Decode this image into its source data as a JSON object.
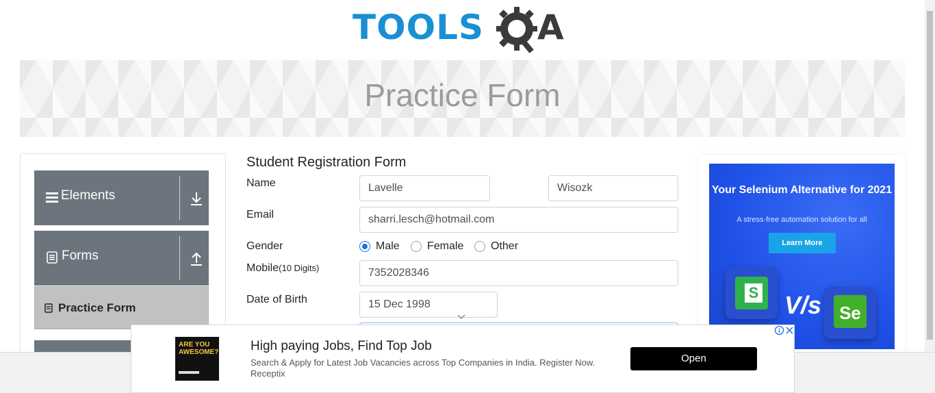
{
  "logo": {
    "text": "TOOLS",
    "suffix": "A",
    "alt": "TOOLSQA",
    "colors": {
      "tools": "#1a8fd4",
      "qa": "#3b3b3b"
    }
  },
  "banner": {
    "title": "Practice Form"
  },
  "sidebar": {
    "groups": [
      {
        "label": "Elements",
        "icon": "hamburger-icon",
        "arrow": "download-arrow-icon"
      },
      {
        "label": "Forms",
        "icon": "document-icon",
        "arrow": "upload-arrow-icon"
      }
    ],
    "active_item": {
      "label": "Practice Form",
      "icon": "form-icon"
    }
  },
  "form": {
    "title": "Student Registration Form",
    "name": {
      "label": "Name",
      "first": "Lavelle",
      "last": "Wisozk"
    },
    "email": {
      "label": "Email",
      "value": "sharri.lesch@hotmail.com"
    },
    "gender": {
      "label": "Gender",
      "options": [
        "Male",
        "Female",
        "Other"
      ],
      "selected": "Male"
    },
    "mobile": {
      "label": "Mobile",
      "hint": "(10 Digits)",
      "value": "7352028346"
    },
    "dob": {
      "label": "Date of Birth",
      "value": "15 Dec 1998"
    }
  },
  "right_ad": {
    "headline": "Your Selenium Alternative for 2021",
    "subline": "A stress-free automation solution for all",
    "button": "Learn More",
    "vs": "V/s",
    "tile_left": "S",
    "tile_right": "Se",
    "colors": {
      "bg": "#1f51e8",
      "button": "#1aa4e8"
    }
  },
  "bottom_ad": {
    "thumb_text": "ARE YOU AWESOME?",
    "title": "High paying Jobs, Find Top Job",
    "description": "Search & Apply for Latest Job Vacancies across Top Companies in India. Register Now.",
    "brand": "Receptix",
    "cta": "Open",
    "info_icon": "info-icon",
    "close_icon": "close-icon"
  },
  "accent": "#1a73e8"
}
